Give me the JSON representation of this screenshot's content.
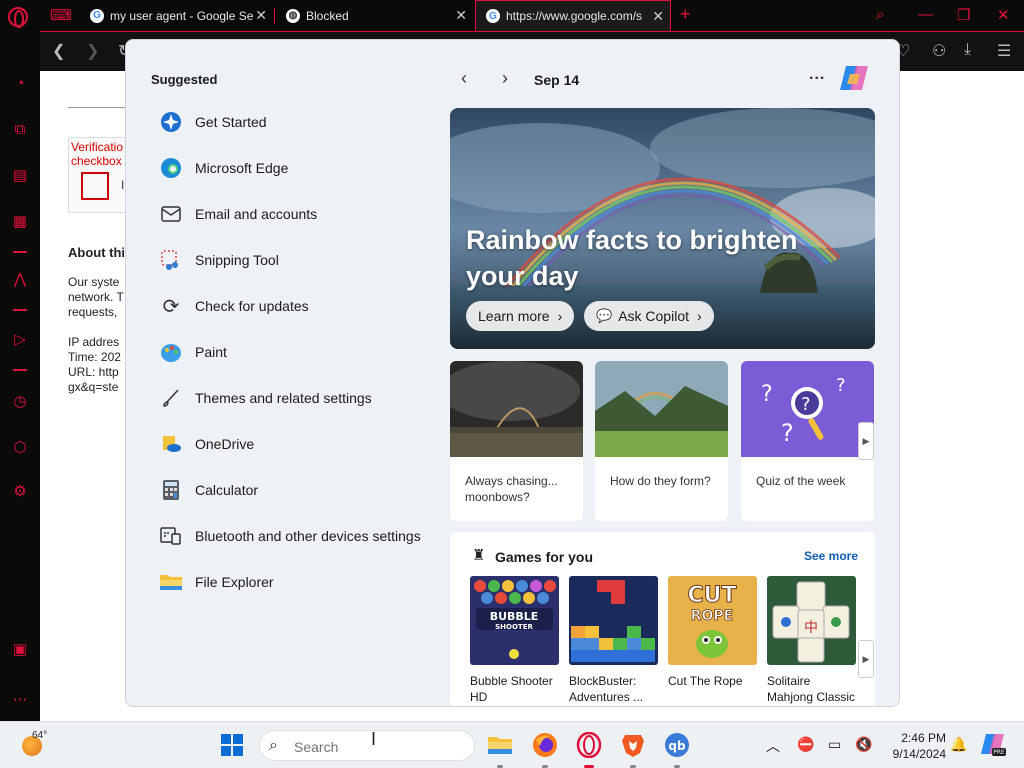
{
  "browser": {
    "tabs": [
      {
        "title": "my user agent - Google Se"
      },
      {
        "title": "Blocked"
      },
      {
        "title": "https://www.google.com/s"
      }
    ],
    "new_tab": "+"
  },
  "background_page": {
    "captcha_label": "Verificatio checkbox",
    "captcha_i": "I",
    "about_heading": "About thi",
    "para1": [
      "Our syste",
      "network. T",
      "requests,"
    ],
    "para2": [
      "IP addres",
      "Time: 202",
      "URL: http",
      "gx&q=ste"
    ]
  },
  "start_menu": {
    "suggested_title": "Suggested",
    "suggested": [
      {
        "label": "Get Started",
        "icon": "get-started-icon"
      },
      {
        "label": "Microsoft Edge",
        "icon": "edge-icon"
      },
      {
        "label": "Email and accounts",
        "icon": "mail-icon"
      },
      {
        "label": "Snipping Tool",
        "icon": "snipping-tool-icon"
      },
      {
        "label": "Check for updates",
        "icon": "refresh-icon"
      },
      {
        "label": "Paint",
        "icon": "paint-icon"
      },
      {
        "label": "Themes and related settings",
        "icon": "brush-icon"
      },
      {
        "label": "OneDrive",
        "icon": "onedrive-icon"
      },
      {
        "label": "Calculator",
        "icon": "calculator-icon"
      },
      {
        "label": "Bluetooth and other devices settings",
        "icon": "devices-icon"
      },
      {
        "label": "File Explorer",
        "icon": "folder-icon"
      }
    ],
    "date": "Sep 14",
    "more": "...",
    "hero": {
      "title": "Rainbow facts to brighten your day",
      "learn_more": "Learn more",
      "ask_copilot": "Ask Copilot"
    },
    "cards": [
      {
        "caption": "Always chasing... moonbows?"
      },
      {
        "caption": "How do they form?"
      },
      {
        "caption": "Quiz of the week"
      }
    ],
    "games": {
      "title": "Games for you",
      "see_more": "See more",
      "items": [
        {
          "name": "Bubble Shooter HD"
        },
        {
          "name": "BlockBuster: Adventures ..."
        },
        {
          "name": "Cut The Rope"
        },
        {
          "name": "Solitaire Mahjong Classic"
        }
      ]
    }
  },
  "taskbar": {
    "weather_temp": "64°",
    "search_placeholder": "Search",
    "time": "2:46 PM",
    "date": "9/14/2024"
  },
  "colors": {
    "accent_opera": "#e0103a",
    "start_bg": "#eef2f6",
    "link_blue": "#0f5bb5"
  }
}
